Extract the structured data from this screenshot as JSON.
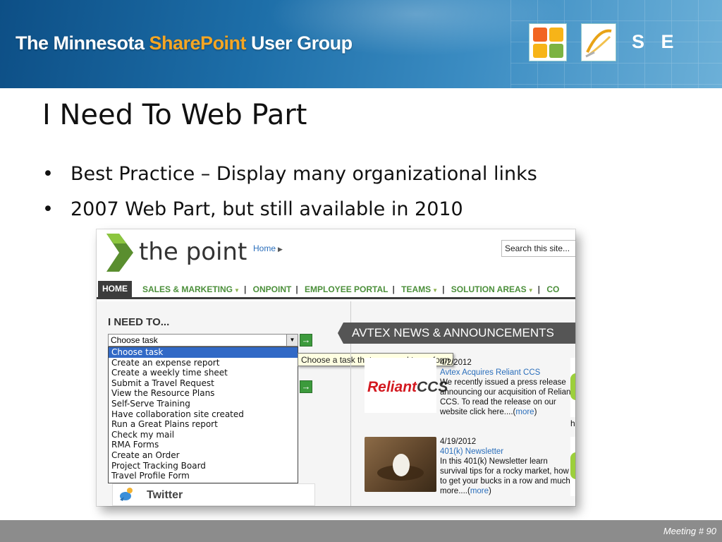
{
  "banner": {
    "title_part1": "The Minnesota ",
    "title_accent": "SharePoint",
    "title_part2": " User Group",
    "se_text": "S E",
    "office_logo_icon": "office-logo-icon",
    "sharepoint_logo_icon": "sharepoint-logo-icon",
    "accent_color": "#f5a623"
  },
  "slide": {
    "title": "I Need To Web Part",
    "bullets": [
      "Best Practice – Display many organizational links",
      "2007 Web Part, but still available in 2010"
    ],
    "bullet_glyph": "•"
  },
  "screenshot": {
    "site_name": "the point",
    "breadcrumb_home": "Home",
    "search_placeholder": "Search this site...",
    "nav": {
      "home": "HOME",
      "items": [
        "SALES & MARKETING",
        "ONPOINT",
        "EMPLOYEE PORTAL",
        "TEAMS",
        "SOLUTION AREAS",
        "CO"
      ]
    },
    "ineed": {
      "title": "I NEED TO...",
      "select_value": "Choose task",
      "tooltip": "Choose a task that you need to perform",
      "options": [
        "Choose task",
        "Create an expense report",
        "Create a weekly time sheet",
        "Submit a Travel Request",
        "View the Resource Plans",
        "Self-Serve Training",
        "Have collaboration site created",
        "Run a Great Plains report",
        "Check my mail",
        "RMA Forms",
        "Create an Order",
        "Project Tracking Board",
        "Travel Profile Form"
      ],
      "selected_index": 0
    },
    "twitter_label": "Twitter",
    "news": {
      "header": "AVTEX NEWS & ANNOUNCEMENTS",
      "items": [
        {
          "date": "4/2/2012",
          "title": "Avtex Acquires Reliant CCS",
          "body": "We recently issued a press release announcing our acquisition of Reliant CCS. To read the release on our website click here....(",
          "more": "more",
          "close": ")",
          "brand_main": "Reliant",
          "brand_suffix": "CCS"
        },
        {
          "date": "4/19/2012",
          "title": "401(k) Newsletter",
          "body": "In this 401(k) Newsletter learn survival tips for a rocky market, how to get your bucks in a row and much more....(",
          "more": "more",
          "close": ")"
        }
      ],
      "side_fragment": "h"
    }
  },
  "footer": {
    "meeting": "Meeting # 90"
  }
}
